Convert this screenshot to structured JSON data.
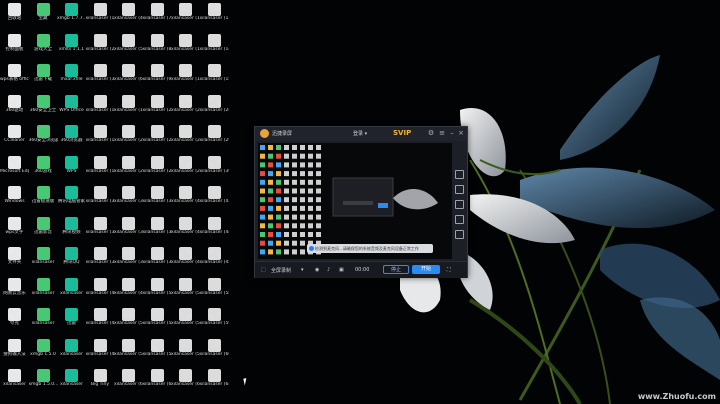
{
  "desktop": {
    "watermark": "www.Zhuofu.com",
    "icons": [
      "回收站",
      "宝藏",
      "xmgb 1.7.7...",
      "xilansaser (1)",
      "xilansaser (4)",
      "xilansaser (7)",
      "xilansaser (10)",
      "xilansaser (13)",
      "控制面板",
      "游戏大全",
      "xmlts 1.1.1",
      "xilansaser (2)",
      "xilansaser (5)",
      "xilansaser (8)",
      "xilansaser (11)",
      "xilansaser (14)",
      "wps表格 office",
      "迅雷下载",
      "mxaf.xfile",
      "xilansaser (3)",
      "xilansaser (6)",
      "xilansaser (9)",
      "xilansaser (12)",
      "xilansaser (15)",
      "360驱动",
      "360安全卫士",
      "WPS Office",
      "xilansaser (16)",
      "xilansaser (19)",
      "xilansaser (22)",
      "xilansaser (25)",
      "xilansaser (28)",
      "CCleaner",
      "360安全浏览器",
      "360浏览器",
      "xilansaser (17)",
      "xilansaser (20)",
      "xilansaser (23)",
      "xilansaser (26)",
      "xilansaser (29)",
      "Microsoft Edge",
      "360游戏",
      "WPS",
      "xilansaser (18)",
      "xilansaser (21)",
      "xilansaser (24)",
      "xilansaser (27)",
      "xilansaser (30)",
      "Windows",
      "迅雷极速版",
      "腾讯电脑管家",
      "xilansaser (31)",
      "xilansaser (34)",
      "xilansaser (37)",
      "xilansaser (40)",
      "xilansaser (43)",
      "wps文字",
      "迅雷影音",
      "腾讯视频",
      "xilansaser (32)",
      "xilansaser (35)",
      "xilansaser (38)",
      "xilansaser (41)",
      "xilansaser (44)",
      "文件夹",
      "xilansaser",
      "腾讯QQ",
      "xilansaser (33)",
      "xilansaser (36)",
      "xilansaser (39)",
      "xilansaser (42)",
      "xilansaser (45)",
      "网易云音乐",
      "xilansaser",
      "xilansaser",
      "xilansaser (46)",
      "xilansaser (49)",
      "xilansaser (52)",
      "xilansaser (55)",
      "xilansaser (58)",
      "夸克",
      "xilansaser",
      "迅雷",
      "xilansaser (47)",
      "xilansaser (50)",
      "xilansaser (53)",
      "xilansaser (56)",
      "xilansaser (59)",
      "搜狗输入法",
      "xmgb 1.5.0",
      "xilansaser",
      "xilansaser (48)",
      "xilansaser (51)",
      "xilansaser (54)",
      "xilansaser (57)",
      "xilansaser (60)",
      "xilansaser",
      "xmgb 1.5.0...",
      "xilansaser",
      "Big Tiny",
      "xilansaser (61)",
      "xilansaser (62)",
      "xilansaser (63)",
      "xilansaser (64)"
    ]
  },
  "recorder": {
    "username": "迅捷录屏",
    "unlock": "登录 ▾",
    "svip": "SVIP",
    "notice": "检测到麦克风...请确保您的系统音频及麦克风设备正常工作",
    "mode": "全屏录制",
    "timer": "00:00",
    "stop": "停止",
    "start": "开始"
  },
  "colors": {
    "accent": "#2a8cf0",
    "svip": "#f1b437"
  }
}
